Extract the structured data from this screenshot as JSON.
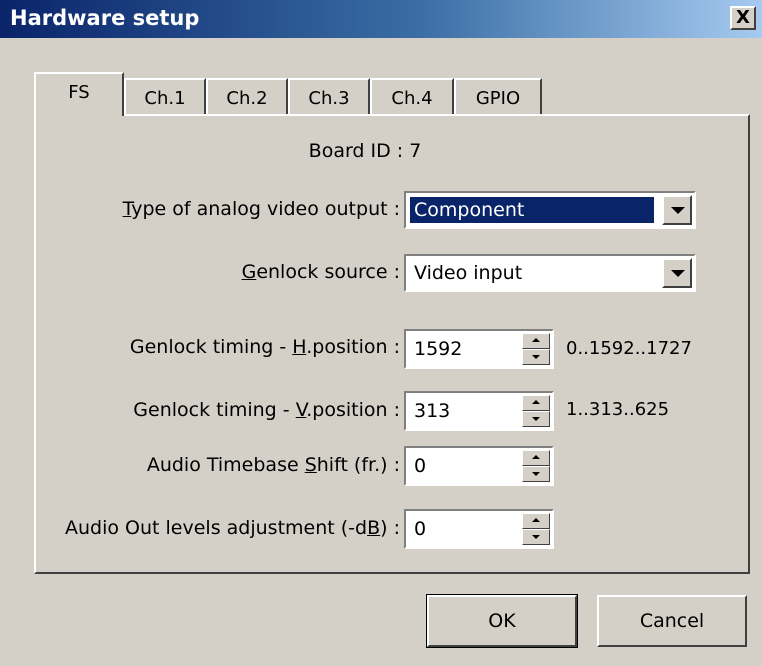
{
  "window": {
    "title": "Hardware setup",
    "close_glyph": "X"
  },
  "tabs": [
    {
      "label": "FS",
      "active": true
    },
    {
      "label": "Ch.1",
      "active": false
    },
    {
      "label": "Ch.2",
      "active": false
    },
    {
      "label": "Ch.3",
      "active": false
    },
    {
      "label": "Ch.4",
      "active": false
    },
    {
      "label": "GPIO",
      "active": false
    }
  ],
  "board_id": "Board ID : 7",
  "fields": {
    "analog_type": {
      "label_pre": "",
      "label_u": "T",
      "label_post": "ype of analog video output :",
      "value": "Component"
    },
    "genlock_source": {
      "label_pre": "",
      "label_u": "G",
      "label_post": "enlock source :",
      "value": "Video input"
    },
    "h_position": {
      "label_pre": "Genlock timing - ",
      "label_u": "H",
      "label_post": ".position :",
      "value": "1592",
      "range": "0..1592..1727"
    },
    "v_position": {
      "label_pre": "Genlock timing - ",
      "label_u": "V",
      "label_post": ".position :",
      "value": "313",
      "range": "1..313..625"
    },
    "audio_timebase": {
      "label_pre": "Audio Timebase ",
      "label_u": "S",
      "label_post": "hift (fr.) :",
      "value": "0"
    },
    "audio_levels": {
      "label_pre": "Audio Out levels adjustment (-d",
      "label_u": "B",
      "label_post": ") :",
      "value": "0"
    }
  },
  "buttons": {
    "ok": "OK",
    "cancel": "Cancel"
  },
  "colors": {
    "face": "#d4d0c8",
    "selection": "#0a246a",
    "title_start": "#0a246a"
  }
}
